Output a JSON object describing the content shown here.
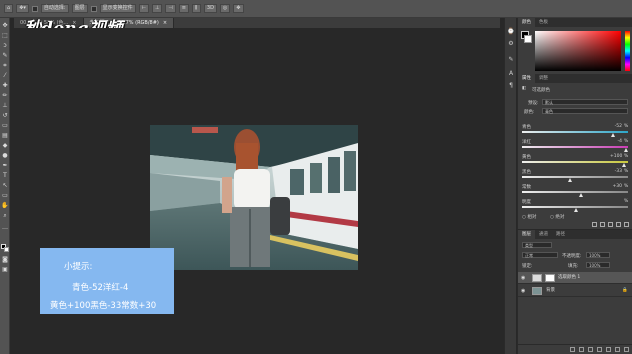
{
  "logo": {
    "text": "秒dong视频"
  },
  "options_bar": {
    "auto_select": "自动选择:",
    "layer": "图层",
    "transform_controls": "显示变换控件"
  },
  "tabs": [
    {
      "label": "00.jpg @ 50% (色...",
      "active": false
    },
    {
      "label": "未标题-1 @ 66.7% (RGB/8#)",
      "active": true
    },
    {
      "label": "x",
      "active": false
    }
  ],
  "tip": {
    "title": "小提示:",
    "line1": "青色-52洋红-4",
    "line2": "黄色+100黑色-33常数+30"
  },
  "color_panel": {
    "tabs": [
      "颜色",
      "色板"
    ],
    "fg": "#000000",
    "bg": "#ffffff"
  },
  "properties_panel": {
    "tabs": [
      "属性",
      "调整"
    ],
    "title": "可选颜色",
    "preset_label": "预设:",
    "preset_value": "默认",
    "colors_label": "颜色:",
    "colors_value": "青色",
    "relative_label": "相对",
    "absolute_label": "绝对",
    "sliders": [
      {
        "label": "青色",
        "value": "-52",
        "pos": 0.86,
        "color": "#2ca6c8"
      },
      {
        "label": "洋红",
        "value": "-4",
        "pos": 0.98,
        "color": "#c83cb4"
      },
      {
        "label": "黄色",
        "value": "+100",
        "pos": 0.96,
        "color": "#c8c83c"
      },
      {
        "label": "黑色",
        "value": "-33",
        "pos": 0.44,
        "color": "#888888"
      },
      {
        "label": "常数",
        "value": "+30",
        "pos": 0.55,
        "color": "#888888"
      },
      {
        "label": "明度",
        "value": "",
        "pos": 0.5,
        "color": "#888888"
      }
    ],
    "percent": "%"
  },
  "layers_panel": {
    "tabs": [
      "图层",
      "通道",
      "路径"
    ],
    "kind_label": "类型",
    "blend_mode": "正常",
    "opacity_label": "不透明度:",
    "opacity_value": "100%",
    "lock_label": "锁定:",
    "fill_label": "填充:",
    "fill_value": "100%",
    "layers": [
      {
        "name": "选取颜色 1",
        "selected": true
      },
      {
        "name": "背景",
        "selected": false
      }
    ]
  }
}
